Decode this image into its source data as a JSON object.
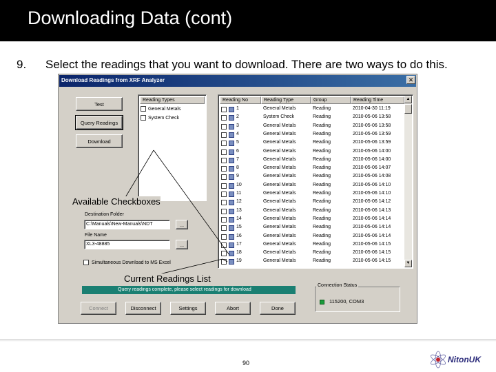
{
  "slide": {
    "title": "Downloading Data (cont)",
    "step_number": "9.",
    "step_text": "Select the readings that you want to download. There are two ways to do this.",
    "page_number": "90",
    "brand": "NitonUK"
  },
  "dialog": {
    "title": "Download Readings from XRF Analyzer",
    "buttons": {
      "test": "Test",
      "query": "Query Readings",
      "download": "Download",
      "connect": "Connect",
      "disconnect": "Disconnect",
      "settings": "Settings",
      "abort": "Abort",
      "done": "Done",
      "browse_folder": "...",
      "browse_file": "..."
    },
    "reading_types": {
      "header": "Reading Types",
      "items": [
        "General Metals",
        "System Check"
      ]
    },
    "readings_table": {
      "headers": [
        "Reading No",
        "Reading Type",
        "Group",
        "Reading Time"
      ],
      "rows": [
        {
          "no": "1",
          "type": "General Metals",
          "group": "Reading",
          "time": "2010-04-30 11:19"
        },
        {
          "no": "2",
          "type": "System Check",
          "group": "Reading",
          "time": "2010-05-06 13:58"
        },
        {
          "no": "3",
          "type": "General Metals",
          "group": "Reading",
          "time": "2010-05-06 13:58"
        },
        {
          "no": "4",
          "type": "General Metals",
          "group": "Reading",
          "time": "2010-05-06 13:59"
        },
        {
          "no": "5",
          "type": "General Metals",
          "group": "Reading",
          "time": "2010-05-06 13:59"
        },
        {
          "no": "6",
          "type": "General Metals",
          "group": "Reading",
          "time": "2010-05-06 14:00"
        },
        {
          "no": "7",
          "type": "General Metals",
          "group": "Reading",
          "time": "2010-05-06 14:00"
        },
        {
          "no": "8",
          "type": "General Metals",
          "group": "Reading",
          "time": "2010-05-06 14:07"
        },
        {
          "no": "9",
          "type": "General Metals",
          "group": "Reading",
          "time": "2010-05-06 14:08"
        },
        {
          "no": "10",
          "type": "General Metals",
          "group": "Reading",
          "time": "2010-05-06 14:10"
        },
        {
          "no": "11",
          "type": "General Metals",
          "group": "Reading",
          "time": "2010-05-06 14:10"
        },
        {
          "no": "12",
          "type": "General Metals",
          "group": "Reading",
          "time": "2010-05-06 14:12"
        },
        {
          "no": "13",
          "type": "General Metals",
          "group": "Reading",
          "time": "2010-05-06 14:13"
        },
        {
          "no": "14",
          "type": "General Metals",
          "group": "Reading",
          "time": "2010-05-06 14:14"
        },
        {
          "no": "15",
          "type": "General Metals",
          "group": "Reading",
          "time": "2010-05-06 14:14"
        },
        {
          "no": "16",
          "type": "General Metals",
          "group": "Reading",
          "time": "2010-05-06 14:14"
        },
        {
          "no": "17",
          "type": "General Metals",
          "group": "Reading",
          "time": "2010-05-06 14:15"
        },
        {
          "no": "18",
          "type": "General Metals",
          "group": "Reading",
          "time": "2010-05-06 14:15"
        },
        {
          "no": "19",
          "type": "General Metals",
          "group": "Reading",
          "time": "2010-05-06 14:15"
        }
      ]
    },
    "destination_folder": {
      "label": "Destination Folder",
      "value": "C:\\Manuals\\New-Manuals\\NDT"
    },
    "file_name": {
      "label": "File Name",
      "value": "XL3-48885"
    },
    "simultaneous_label": "Simultaneous Download to MS Excel",
    "status_message": "Query readings complete, please select readings for download",
    "connection": {
      "group_label": "Connection Status",
      "value": "115200, COM3"
    },
    "annotations": {
      "checkboxes": "Available Checkboxes",
      "readings_list": "Current Readings List"
    }
  },
  "colors": {
    "title_bar": "#000000",
    "dialog_face": "#d4d0c8",
    "status_bar": "#1a7f72",
    "connected_led": "#1a9a3a"
  }
}
